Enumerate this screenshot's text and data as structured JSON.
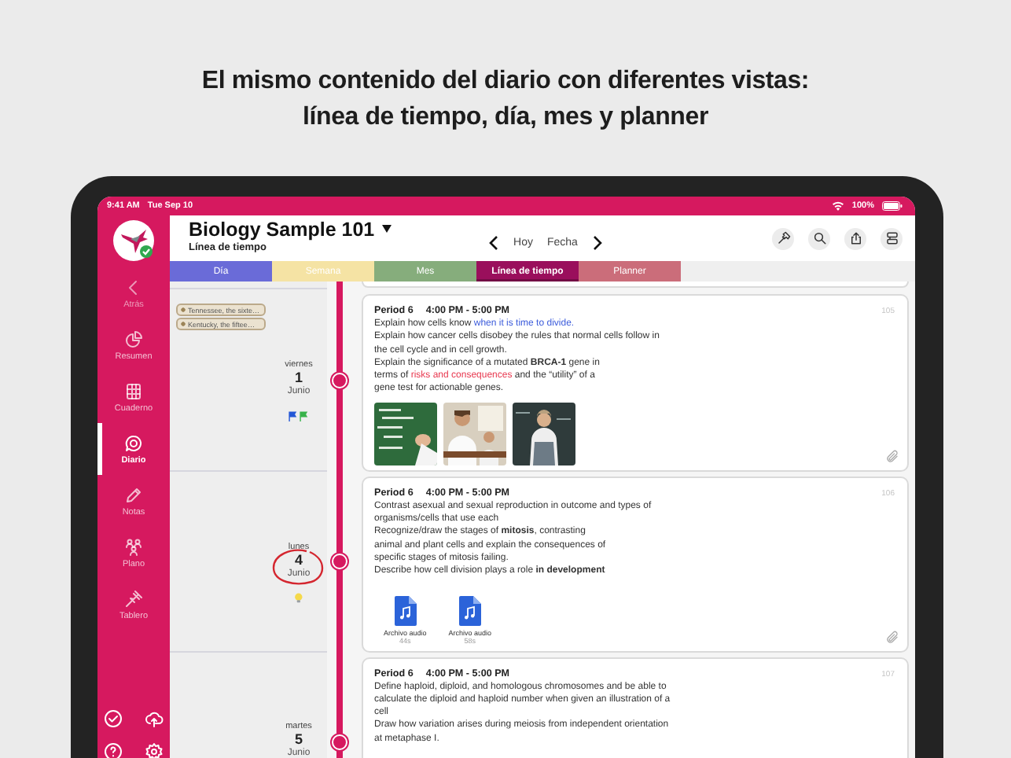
{
  "headline": "El mismo contenido del diario con diferentes vistas:\nlínea de tiempo, día, mes y planner",
  "status_bar": {
    "time": "9:41 AM",
    "date": "Tue Sep 10",
    "battery": "100%"
  },
  "sidebar": {
    "back": "Atrás",
    "items": [
      {
        "label": "Resumen",
        "kind": "summary",
        "selected": false
      },
      {
        "label": "Cuaderno",
        "kind": "notebook",
        "selected": false
      },
      {
        "label": "Diario",
        "kind": "journal",
        "selected": true
      },
      {
        "label": "Notas",
        "kind": "notes",
        "selected": false
      },
      {
        "label": "Plano",
        "kind": "plan",
        "selected": false
      },
      {
        "label": "Tablero",
        "kind": "board",
        "selected": false
      }
    ]
  },
  "header": {
    "title": "Biology Sample 101",
    "subtitle": "Línea de tiempo",
    "nav": [
      "Hoy",
      "Fecha"
    ]
  },
  "tabs": [
    {
      "label": "Día",
      "color": "#6a6bd8",
      "selected": false
    },
    {
      "label": "Semana",
      "color": "#f5e3a4",
      "selected": false
    },
    {
      "label": "Mes",
      "color": "#86ad7c",
      "selected": false
    },
    {
      "label": "Línea de tiempo",
      "color": "#9a0f5c",
      "selected": true
    },
    {
      "label": "Planner",
      "color": "#cb6d7a",
      "selected": false
    }
  ],
  "timeline": {
    "rows": [
      {
        "date": {
          "weekday": "viernes",
          "day": "1",
          "month": "Junio",
          "circled": false
        },
        "tags": [
          "Tennessee, the sixte…",
          "Kentucky, the fiftee…"
        ],
        "marker": {
          "kind": "flags"
        },
        "entry": {
          "period": "Period 6",
          "time": "4:00 PM - 5:00 PM",
          "number": "105",
          "paragraphs": [
            [
              {
                "text": "Explain how cells know "
              },
              {
                "text": "when it is time to divide.",
                "color": "#3b5bdb"
              }
            ],
            [
              {
                "text": "Explain how cancer cells disobey the rules that normal cells follow in\nthe cell cycle and in cell growth."
              }
            ],
            [
              {
                "text": "Explain the significance of a mutated **BRCA-1** gene in\nterms of "
              },
              {
                "text": "risks and consequences",
                "color": "#e8384f"
              },
              {
                "text": " and the “utility” of a\ngene test for actionable genes."
              }
            ]
          ],
          "attachments": [
            {
              "kind": "picture"
            },
            {
              "kind": "picture"
            },
            {
              "kind": "picture"
            }
          ]
        }
      },
      {
        "date": {
          "weekday": "lunes",
          "day": "4",
          "month": "Junio",
          "circled": true
        },
        "marker": {
          "kind": "bulb"
        },
        "entry": {
          "period": "Period 6",
          "time": "4:00 PM - 5:00 PM",
          "number": "106",
          "paragraphs": [
            [
              {
                "text": "Contrast asexual and sexual reproduction in outcome and types of\norganisms/cells that use each"
              }
            ],
            [
              {
                "text": "Recognize/draw the stages of **mitosis**, contrasting\nanimal and plant cells and explain the consequences of\nspecific stages of mitosis failing."
              }
            ],
            [
              {
                "text": "Describe how cell division plays a role **in development**"
              }
            ]
          ],
          "attachments": [
            {
              "kind": "audio",
              "label": "Archivo audio",
              "duration": "44s"
            },
            {
              "kind": "audio",
              "label": "Archivo audio",
              "duration": "58s"
            }
          ]
        }
      },
      {
        "date": {
          "weekday": "martes",
          "day": "5",
          "month": "Junio",
          "circled": false
        },
        "entry": {
          "period": "Period 6",
          "time": "4:00 PM - 5:00 PM",
          "number": "107",
          "paragraphs": [
            [
              {
                "text": "Define haploid, diploid, and homologous chromosomes and be able to\ncalculate the diploid and haploid number when given an illustration of a\ncell"
              }
            ],
            [
              {
                "text": "Draw how variation arises during meiosis from independent orientation\nat metaphase I."
              }
            ]
          ]
        }
      }
    ]
  }
}
